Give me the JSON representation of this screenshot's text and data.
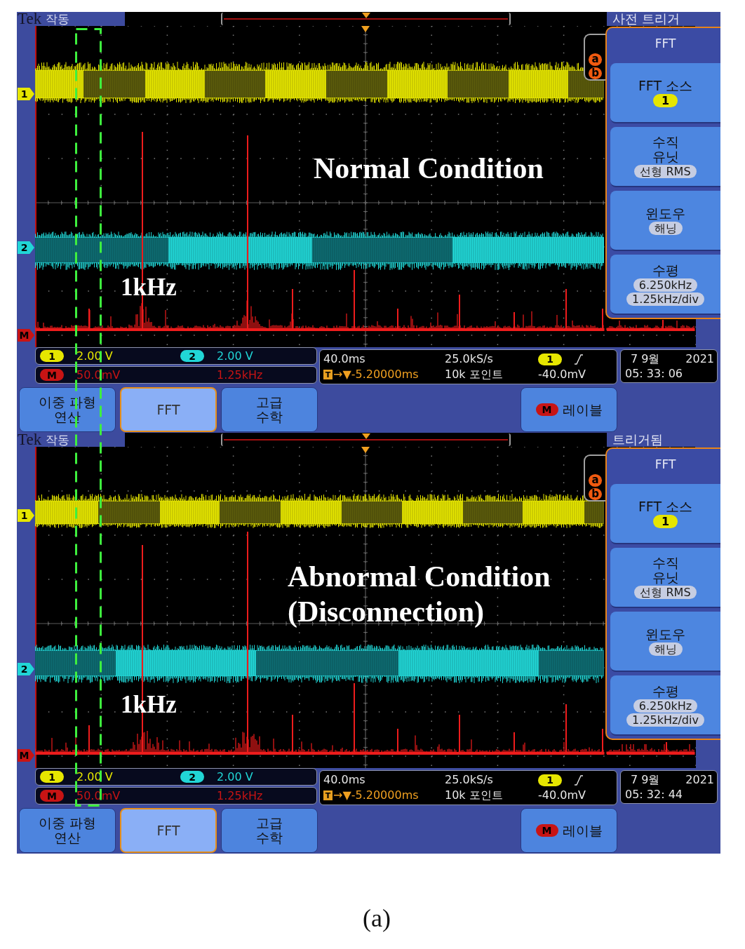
{
  "panels": [
    {
      "header": {
        "brand": "Tek",
        "run_state": "작동",
        "trigger_state": "사전 트리거"
      },
      "annotation": "Normal Condition",
      "peak_label": "1kHz",
      "channel_markers": [
        {
          "label": "1",
          "color": "#e6e600"
        },
        {
          "label": "2",
          "color": "#21d6d6"
        },
        {
          "label": "M",
          "color": "#c81414"
        }
      ],
      "cursors": [
        "a",
        "b"
      ],
      "menu": {
        "title": "FFT",
        "items": [
          {
            "label": "FFT 소스",
            "kind": "channel",
            "values": [
              "1"
            ],
            "color": "#e6e600"
          },
          {
            "label": "수직\n유닛",
            "kind": "option",
            "values": [
              "선형 RMS"
            ]
          },
          {
            "label": "윈도우",
            "kind": "option",
            "values": [
              "해닝"
            ]
          },
          {
            "label": "수평",
            "kind": "option",
            "values": [
              "6.250kHz",
              "1.25kHz/div"
            ]
          }
        ]
      },
      "readouts": [
        [
          {
            "badge": "1",
            "value": "2.00 V",
            "color": "#e6e600"
          },
          {
            "badge": "2",
            "value": "2.00 V",
            "color": "#21d6d6"
          }
        ],
        [
          {
            "badge": "M",
            "value": "50.0mV",
            "horizontal_scale": "1.25kHz",
            "color": "#c81414"
          }
        ]
      ],
      "acquisition": {
        "time_scale": "40.0ms",
        "sample_rate": "25.0kS/s",
        "trigger_source": {
          "label": "1",
          "color": "#e6e600"
        },
        "trigger_badge": "T",
        "delay": "→▼-5.20000ms",
        "record_length": "10k 포인트",
        "trigger_level": "-40.0mV"
      },
      "clock": {
        "date": "7 9월",
        "year": "2021",
        "time": "05: 33: 06"
      },
      "buttons": [
        {
          "label": "이중 파형\n연산",
          "selected": false
        },
        {
          "label": "FFT",
          "selected": true
        },
        {
          "label": "고급\n수학",
          "selected": false
        },
        {
          "label": "레이블",
          "badge": "M",
          "color": "#c81414",
          "selected": false
        }
      ]
    },
    {
      "header": {
        "brand": "Tek",
        "run_state": "작동",
        "trigger_state": "트리거됨"
      },
      "annotation": "Abnormal Condition\n(Disconnection)",
      "peak_label": "1kHz",
      "channel_markers": [
        {
          "label": "1",
          "color": "#e6e600"
        },
        {
          "label": "2",
          "color": "#21d6d6"
        },
        {
          "label": "M",
          "color": "#c81414"
        }
      ],
      "cursors": [
        "a",
        "b"
      ],
      "menu": {
        "title": "FFT",
        "items": [
          {
            "label": "FFT 소스",
            "kind": "channel",
            "values": [
              "1"
            ],
            "color": "#e6e600"
          },
          {
            "label": "수직\n유닛",
            "kind": "option",
            "values": [
              "선형 RMS"
            ]
          },
          {
            "label": "윈도우",
            "kind": "option",
            "values": [
              "해닝"
            ]
          },
          {
            "label": "수평",
            "kind": "option",
            "values": [
              "6.250kHz",
              "1.25kHz/div"
            ]
          }
        ]
      },
      "readouts": [
        [
          {
            "badge": "1",
            "value": "2.00 V",
            "color": "#e6e600"
          },
          {
            "badge": "2",
            "value": "2.00 V",
            "color": "#21d6d6"
          }
        ],
        [
          {
            "badge": "M",
            "value": "50.0mV",
            "horizontal_scale": "1.25kHz",
            "color": "#c81414"
          }
        ]
      ],
      "acquisition": {
        "time_scale": "40.0ms",
        "sample_rate": "25.0kS/s",
        "trigger_source": {
          "label": "1",
          "color": "#e6e600"
        },
        "trigger_badge": "T",
        "delay": "→▼-5.20000ms",
        "record_length": "10k 포인트",
        "trigger_level": "-40.0mV"
      },
      "clock": {
        "date": "7 9월",
        "year": "2021",
        "time": "05: 32: 44"
      },
      "buttons": [
        {
          "label": "이중 파형\n연산",
          "selected": false
        },
        {
          "label": "FFT",
          "selected": true
        },
        {
          "label": "고급\n수학",
          "selected": false
        },
        {
          "label": "레이블",
          "badge": "M",
          "color": "#c81414",
          "selected": false
        }
      ]
    }
  ],
  "caption": "(a)"
}
